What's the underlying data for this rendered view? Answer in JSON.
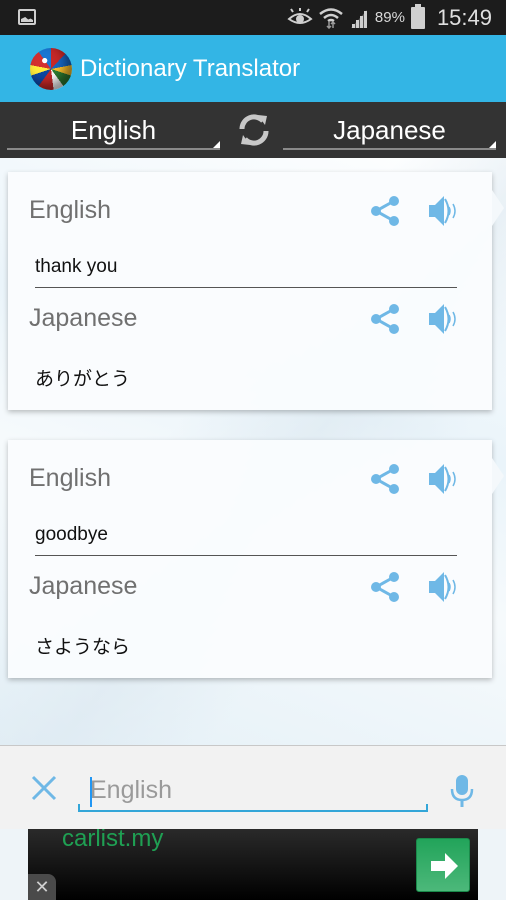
{
  "status_bar": {
    "battery_percent": "89%",
    "time": "15:49",
    "icons": [
      "gallery-icon",
      "eye-icon",
      "wifi-icon",
      "signal-icon",
      "battery-icon"
    ]
  },
  "app_bar": {
    "title": "Dictionary Translator",
    "logo": "globe-flags-icon"
  },
  "language_bar": {
    "source_language": "English",
    "target_language": "Japanese",
    "swap_icon": "swap-arrows-icon"
  },
  "translations": [
    {
      "source_label": "English",
      "source_text": "thank you",
      "target_label": "Japanese",
      "target_text": "ありがとう"
    },
    {
      "source_label": "English",
      "source_text": "goodbye",
      "target_label": "Japanese",
      "target_text": "さようなら"
    }
  ],
  "input": {
    "value": "",
    "placeholder": "English",
    "clear_icon": "close-icon",
    "voice_icon": "microphone-icon"
  },
  "ad": {
    "text": "carlist.my",
    "close_label": "✕"
  },
  "colors": {
    "accent": "#33b5e5",
    "icon_blue": "#6fb8e6",
    "ad_green": "#1fa053"
  }
}
